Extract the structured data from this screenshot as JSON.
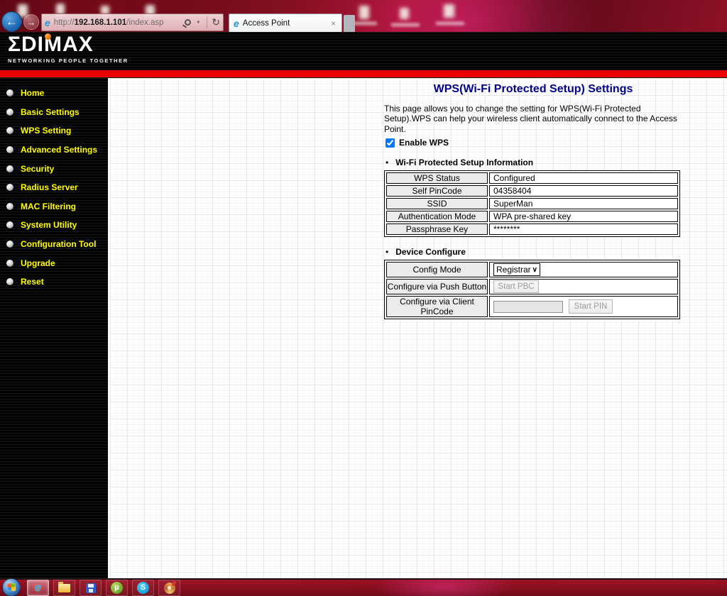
{
  "browser": {
    "url_prefix": "http://",
    "url_host": "192.168.1.101",
    "url_path": "/index.asp",
    "tab": {
      "title": "Access Point"
    }
  },
  "icons": {
    "back": "←",
    "forward": "→",
    "refresh": "↻",
    "caret": "▼",
    "close": "×",
    "ie": "e",
    "chevron": "∨",
    "bullet": "•",
    "utorrent": "µ",
    "skype": "S"
  },
  "header": {
    "logo": "ΣDIMAX",
    "tagline": "NETWORKING PEOPLE TOGETHER"
  },
  "sidebar": {
    "items": [
      {
        "label": "Home"
      },
      {
        "label": "Basic Settings"
      },
      {
        "label": "WPS Setting"
      },
      {
        "label": "Advanced Settings"
      },
      {
        "label": "Security"
      },
      {
        "label": "Radius Server"
      },
      {
        "label": "MAC Filtering"
      },
      {
        "label": "System Utility"
      },
      {
        "label": "Configuration Tool"
      },
      {
        "label": "Upgrade"
      },
      {
        "label": "Reset"
      }
    ]
  },
  "main": {
    "title": "WPS(Wi-Fi Protected Setup) Settings",
    "description": "This page allows you to change the setting for WPS(Wi-Fi Protected Setup).WPS can help your wireless client automatically connect to the Access Point.",
    "enable_wps": {
      "label": "Enable WPS",
      "checked": "checked"
    },
    "info": {
      "heading": "Wi-Fi Protected Setup Information",
      "rows": [
        {
          "label": "WPS Status",
          "value": "Configured"
        },
        {
          "label": "Self PinCode",
          "value": "04358404"
        },
        {
          "label": "SSID",
          "value": "SuperMan"
        },
        {
          "label": "Authentication Mode",
          "value": "WPA pre-shared key"
        },
        {
          "label": "Passphrase Key",
          "value": "********"
        }
      ]
    },
    "device": {
      "heading": "Device Configure",
      "config_mode": {
        "label": "Config Mode",
        "value": "Registrar"
      },
      "push_button": {
        "label": "Configure via Push Button",
        "button": "Start PBC"
      },
      "client_pin": {
        "label": "Configure via Client PinCode",
        "input_value": "",
        "button": "Start PIN"
      }
    }
  },
  "colors": {
    "accent_red_bar": "#ea0000",
    "sidebar_menu_yellow": "#ffff00",
    "page_title_blue": "#00008b",
    "taskbar_red": "#9e1426"
  }
}
